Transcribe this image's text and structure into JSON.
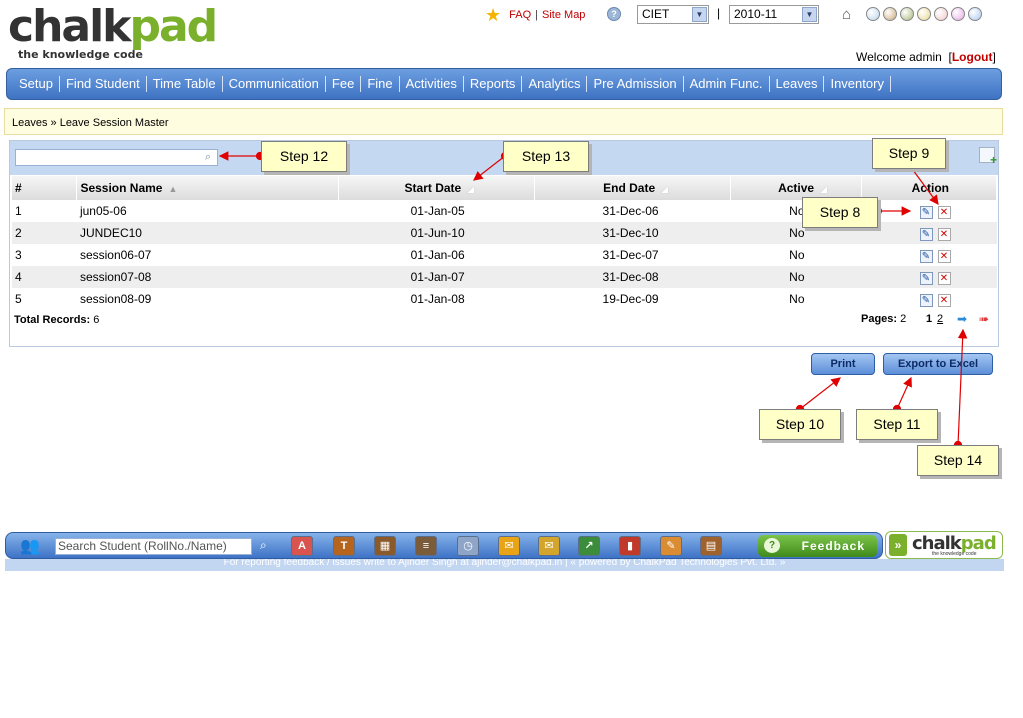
{
  "header": {
    "logo_main": "chalk",
    "logo_accent": "pad",
    "logo_tagline": "the knowledge code",
    "faq": "FAQ",
    "sitemap": "Site Map",
    "separator": "|",
    "institute": "CIET",
    "session": "2010-11",
    "welcome": "Welcome admin",
    "logout": "Logout",
    "theme_colors": [
      "#bcd6ee",
      "#c8a87a",
      "#a8b878",
      "#e8d890",
      "#f3c8c8",
      "#e6a8e6",
      "#a8c8f0"
    ]
  },
  "nav": {
    "items": [
      "Setup",
      "Find Student",
      "Time Table",
      "Communication",
      "Fee",
      "Fine",
      "Activities",
      "Reports",
      "Analytics",
      "Pre Admission",
      "Admin Func.",
      "Leaves",
      "Inventory"
    ]
  },
  "breadcrumb": "Leaves » Leave Session Master",
  "grid": {
    "search_value": "",
    "columns": [
      "#",
      "Session Name",
      "Start Date",
      "End Date",
      "Active",
      "Action"
    ],
    "rows": [
      {
        "num": "1",
        "name": "jun05-06",
        "start": "01-Jan-05",
        "end": "31-Dec-06",
        "active": "No"
      },
      {
        "num": "2",
        "name": "JUNDEC10",
        "start": "01-Jun-10",
        "end": "31-Dec-10",
        "active": "No"
      },
      {
        "num": "3",
        "name": "session06-07",
        "start": "01-Jan-06",
        "end": "31-Dec-07",
        "active": "No"
      },
      {
        "num": "4",
        "name": "session07-08",
        "start": "01-Jan-07",
        "end": "31-Dec-08",
        "active": "No"
      },
      {
        "num": "5",
        "name": "session08-09",
        "start": "01-Jan-08",
        "end": "19-Dec-09",
        "active": "No"
      }
    ],
    "total_label": "Total Records:",
    "total_value": "6",
    "pages_label": "Pages:",
    "pages_value": "2",
    "current_page": "1",
    "next_page": "2"
  },
  "buttons": {
    "print": "Print",
    "export": "Export to Excel"
  },
  "callouts": {
    "step8": "Step 8",
    "step9": "Step 9",
    "step10": "Step 10",
    "step11": "Step 11",
    "step12": "Step 12",
    "step13": "Step 13",
    "step14": "Step 14"
  },
  "footer": {
    "search_placeholder": "Search Student (RollNo./Name)",
    "feedback": "Feedback",
    "strip_text": "For reporting feedback / issues write to Ajinder Singh at ajinder@chalkpad.in | « powered by ChalkPad Technologies Pvt. Ltd. »",
    "logo_main": "chalk",
    "logo_accent": "pad",
    "logo_tagline": "the knowledge code",
    "tool_icons": [
      {
        "name": "abc-icon",
        "glyph": "A",
        "color": "#d9534f"
      },
      {
        "name": "test-icon",
        "glyph": "T",
        "color": "#b5651d"
      },
      {
        "name": "timetable-icon",
        "glyph": "▦",
        "color": "#8a5a2b"
      },
      {
        "name": "books-icon",
        "glyph": "≡",
        "color": "#7a5c3a"
      },
      {
        "name": "calendar-clock-icon",
        "glyph": "◷",
        "color": "#8fa5c8"
      },
      {
        "name": "message-icon",
        "glyph": "✉",
        "color": "#e8a317"
      },
      {
        "name": "mail-icon",
        "glyph": "✉",
        "color": "#d4a52c"
      },
      {
        "name": "chart-icon",
        "glyph": "↗",
        "color": "#3b8c3b"
      },
      {
        "name": "bar-chart-icon",
        "glyph": "▮",
        "color": "#c0392b"
      },
      {
        "name": "report-icon",
        "glyph": "✎",
        "color": "#d98c32"
      },
      {
        "name": "book-icon",
        "glyph": "▤",
        "color": "#a0622d"
      }
    ]
  }
}
